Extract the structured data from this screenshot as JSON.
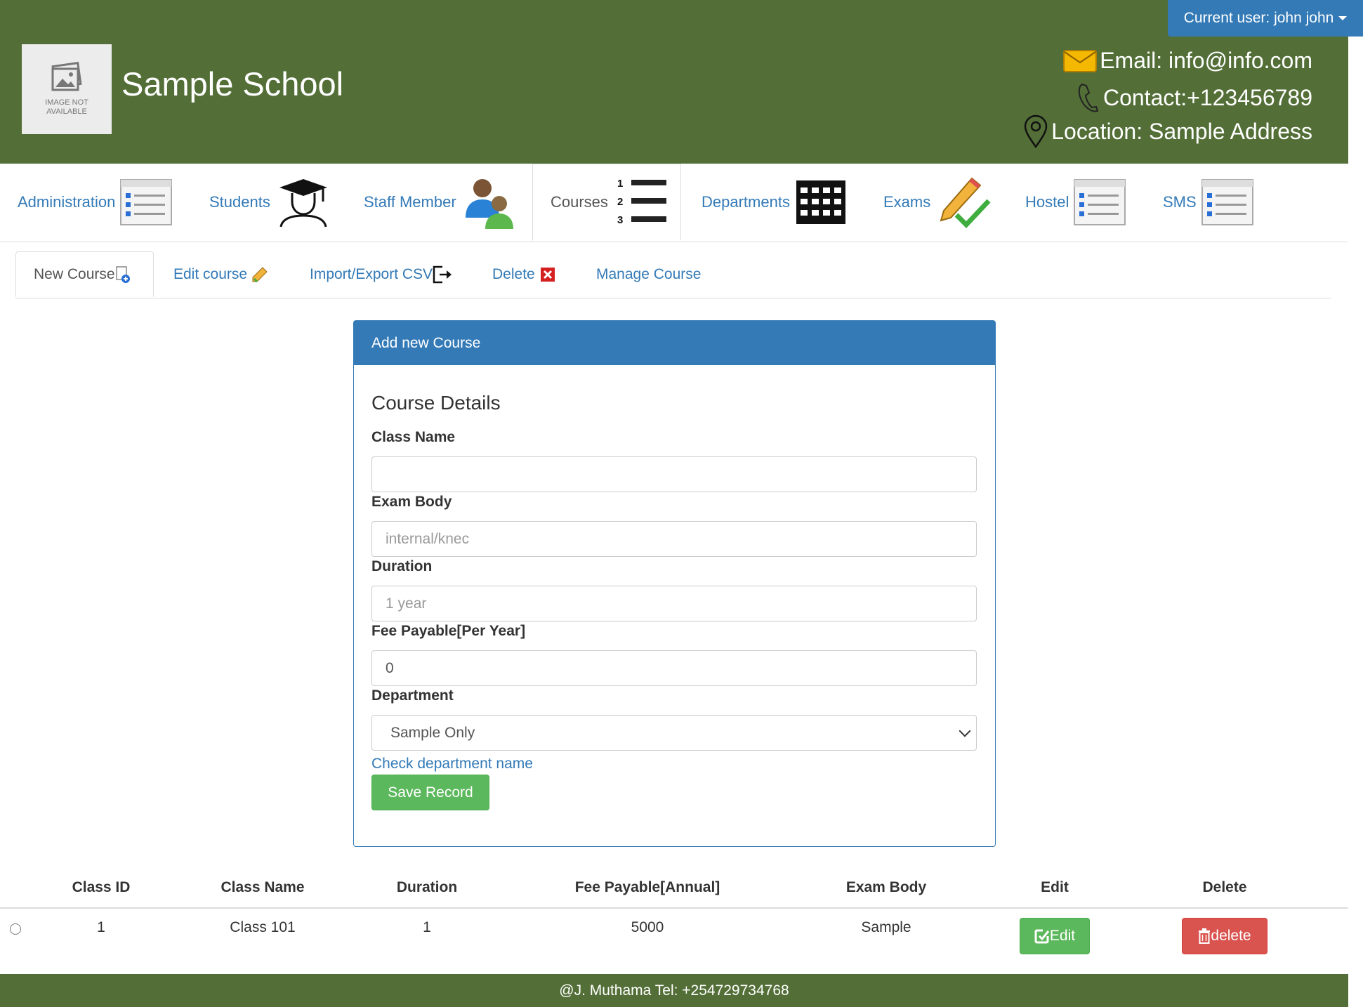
{
  "header": {
    "logo_text": "IMAGE NOT AVAILABLE",
    "school_name": "Sample School",
    "current_user": "Current user: john john",
    "email": "Email: info@info.com",
    "contact": "Contact:+123456789",
    "location": "Location: Sample Address"
  },
  "nav": {
    "items": [
      {
        "label": "Administration",
        "icon": "list-window-icon"
      },
      {
        "label": "Students",
        "icon": "graduate-icon"
      },
      {
        "label": "Staff Member",
        "icon": "people-icon"
      },
      {
        "label": "Courses",
        "icon": "numbered-list-icon",
        "active": true
      },
      {
        "label": "Departments",
        "icon": "building-icon"
      },
      {
        "label": "Exams",
        "icon": "pencil-check-icon"
      },
      {
        "label": "Hostel",
        "icon": "list-window-icon"
      },
      {
        "label": "SMS",
        "icon": "list-window-icon"
      }
    ],
    "numbered_list_digits": [
      "1",
      "2",
      "3"
    ]
  },
  "subtabs": [
    {
      "label": "New Course",
      "icon": "new-doc-icon",
      "active": true
    },
    {
      "label": "Edit course",
      "icon": "edit-pencil-icon"
    },
    {
      "label": "Import/Export CSV",
      "icon": "export-icon"
    },
    {
      "label": "Delete",
      "icon": "red-x-icon"
    },
    {
      "label": "Manage Course"
    }
  ],
  "form": {
    "panel_title": "Add new Course",
    "legend": "Course Details",
    "class_name": {
      "label": "Class Name",
      "value": "",
      "placeholder": ""
    },
    "exam_body": {
      "label": "Exam Body",
      "value": "",
      "placeholder": "internal/knec"
    },
    "duration": {
      "label": "Duration",
      "value": "",
      "placeholder": "1 year"
    },
    "fee": {
      "label": "Fee Payable[Per Year]",
      "value": "0"
    },
    "department": {
      "label": "Department",
      "selected": "Sample Only"
    },
    "check_link": "Check department name",
    "save_label": "Save Record"
  },
  "table": {
    "headers": [
      "Class ID",
      "Class Name",
      "Duration",
      "Fee Payable[Annual]",
      "Exam Body",
      "Edit",
      "Delete"
    ],
    "rows": [
      {
        "class_id": "1",
        "class_name": "Class 101",
        "duration": "1",
        "fee": "5000",
        "exam_body": "Sample",
        "edit_label": "Edit",
        "delete_label": "delete"
      }
    ]
  },
  "footer": {
    "text": "@J. Muthama Tel: +254729734768"
  },
  "colors": {
    "header_green": "#536f37",
    "primary_blue": "#337ab7",
    "success_green": "#5cb85c",
    "danger_red": "#d9534f"
  }
}
